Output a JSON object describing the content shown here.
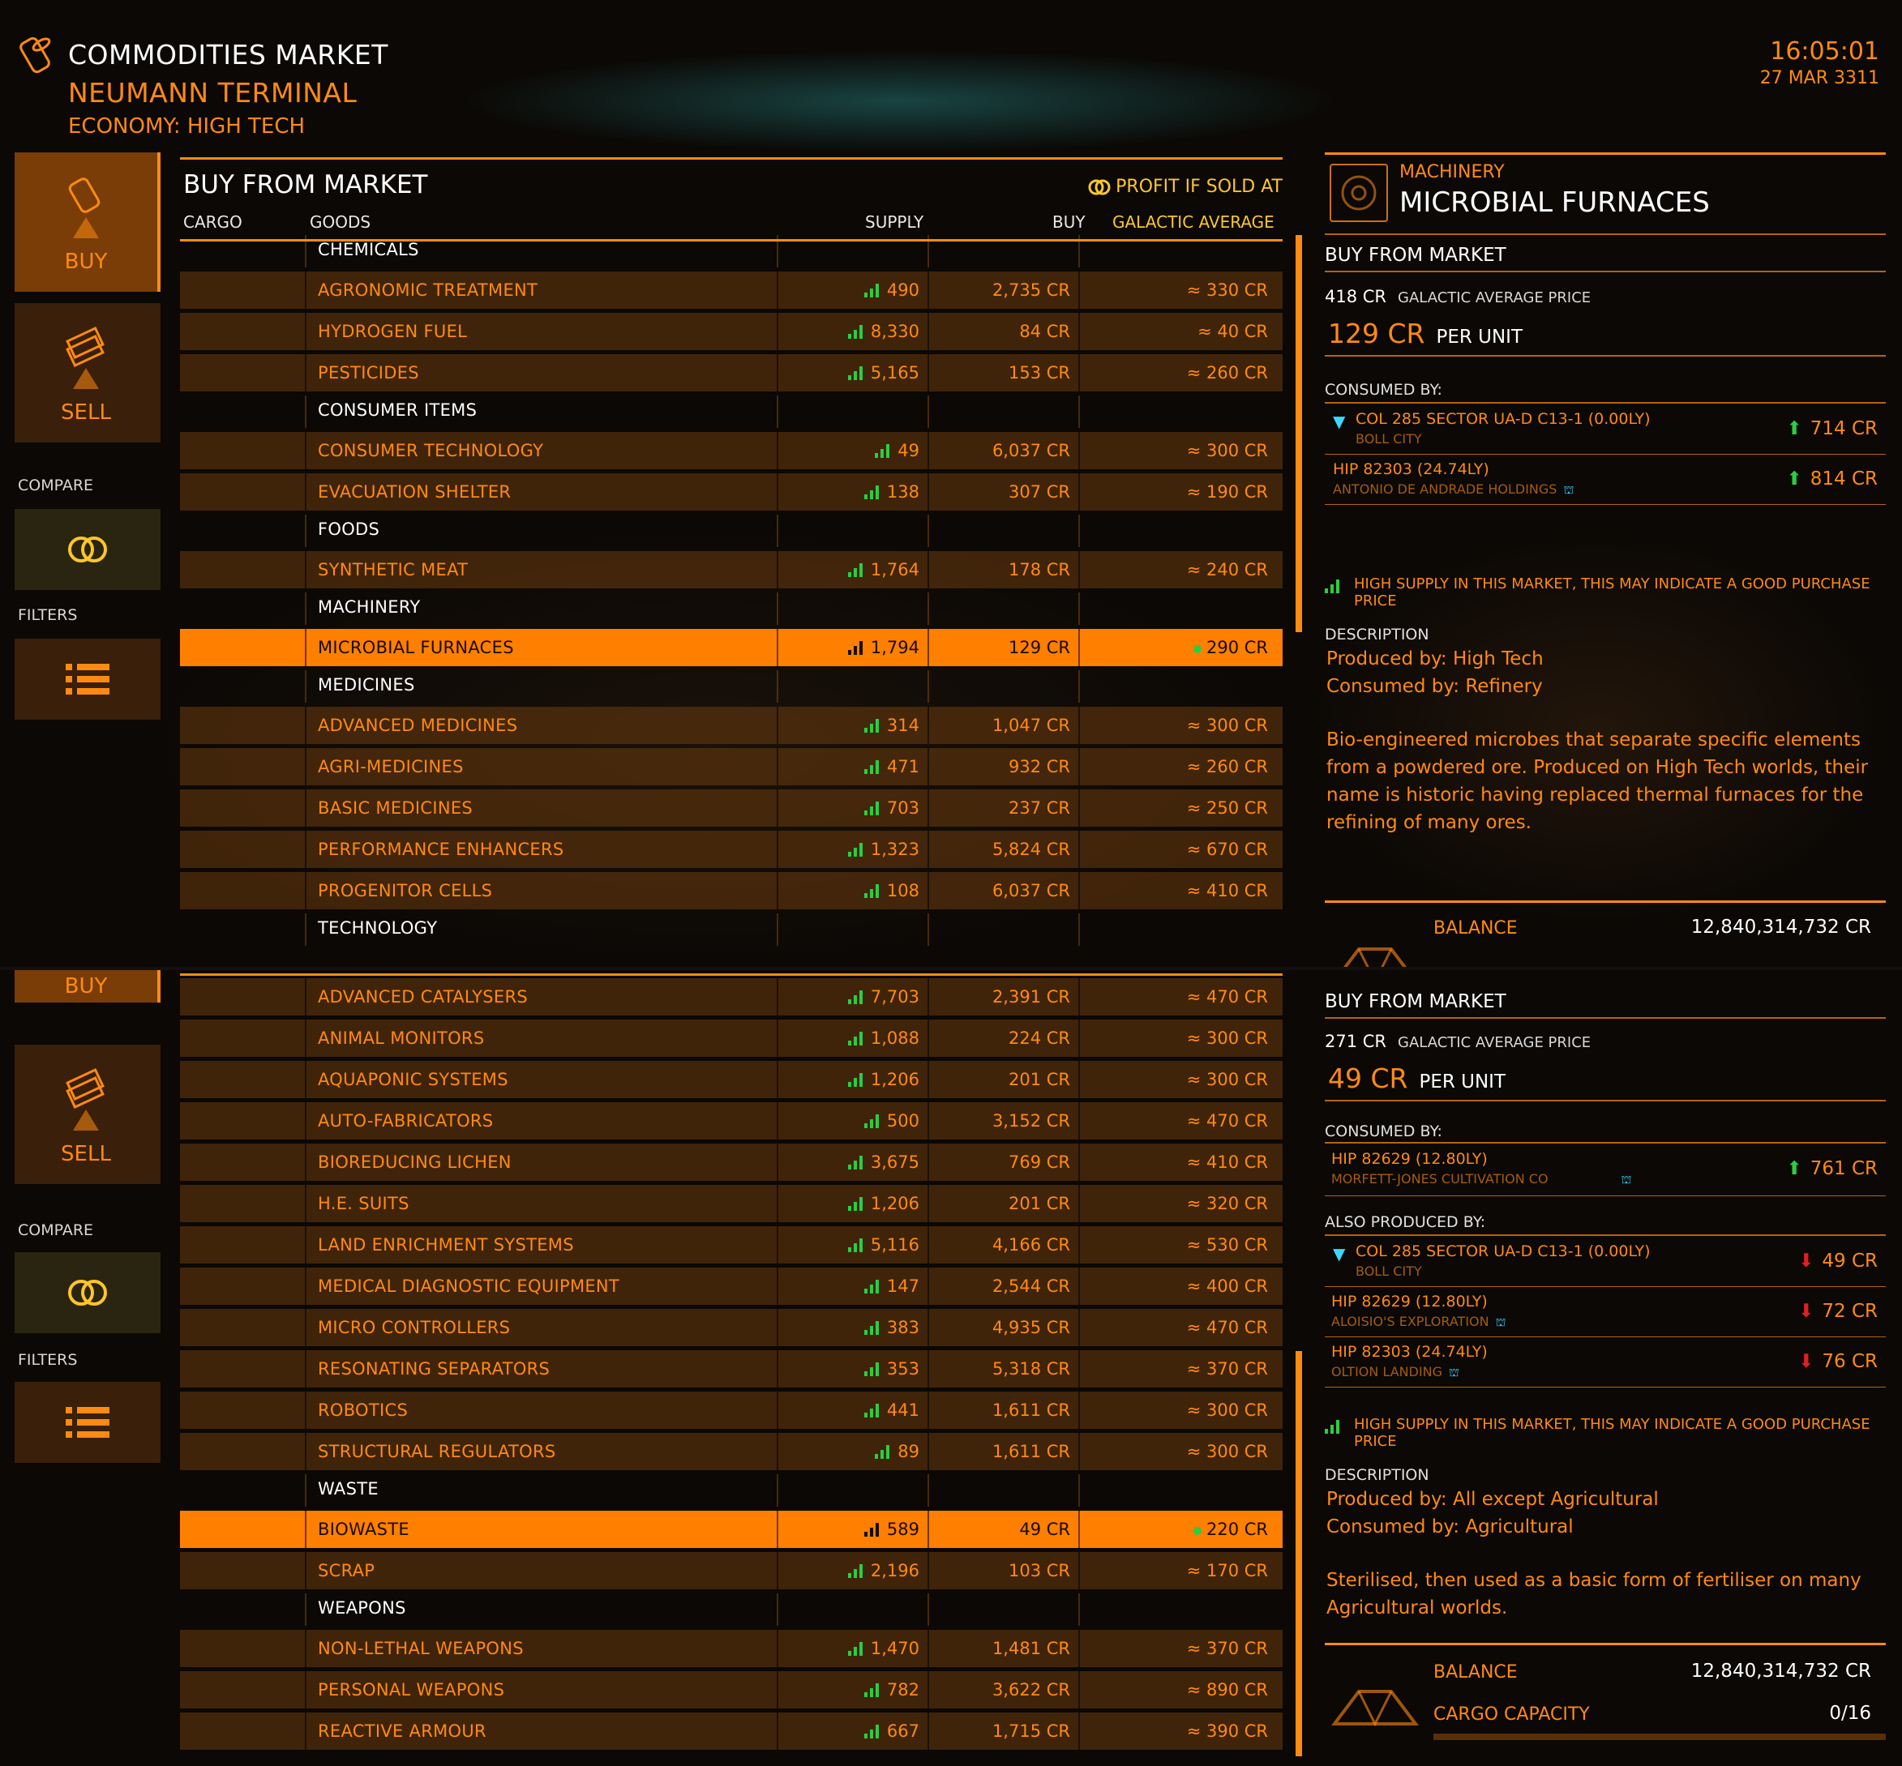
{
  "header": {
    "title": "COMMODITIES MARKET",
    "station": "NEUMANN TERMINAL",
    "economy": "ECONOMY: HIGH TECH",
    "time": "16:05:01",
    "date": "27 MAR 3311"
  },
  "sidebar": {
    "buy": "BUY",
    "sell": "SELL",
    "compare": "COMPARE",
    "filters": "FILTERS"
  },
  "market": {
    "title": "BUY FROM MARKET",
    "profit_label": "PROFIT IF SOLD AT",
    "columns": {
      "cargo": "CARGO",
      "goods": "GOODS",
      "supply": "SUPPLY",
      "buy": "BUY",
      "galactic": "GALACTIC AVERAGE"
    }
  },
  "top_rows": [
    {
      "type": "cat",
      "name": "CHEMICALS"
    },
    {
      "type": "item",
      "name": "AGRONOMIC TREATMENT",
      "supply": "490",
      "buy": "2,735 CR",
      "ga": "≈ 330 CR"
    },
    {
      "type": "item",
      "name": "HYDROGEN FUEL",
      "supply": "8,330",
      "buy": "84 CR",
      "ga": "≈ 40 CR"
    },
    {
      "type": "item",
      "name": "PESTICIDES",
      "supply": "5,165",
      "buy": "153 CR",
      "ga": "≈ 260 CR"
    },
    {
      "type": "cat",
      "name": "CONSUMER ITEMS"
    },
    {
      "type": "item",
      "name": "CONSUMER TECHNOLOGY",
      "supply": "49",
      "buy": "6,037 CR",
      "ga": "≈ 300 CR"
    },
    {
      "type": "item",
      "name": "EVACUATION SHELTER",
      "supply": "138",
      "buy": "307 CR",
      "ga": "≈ 190 CR"
    },
    {
      "type": "cat",
      "name": "FOODS"
    },
    {
      "type": "item",
      "name": "SYNTHETIC MEAT",
      "supply": "1,764",
      "buy": "178 CR",
      "ga": "≈ 240 CR"
    },
    {
      "type": "cat",
      "name": "MACHINERY"
    },
    {
      "type": "sel",
      "name": "MICROBIAL FURNACES",
      "supply": "1,794",
      "buy": "129 CR",
      "ga": "290 CR"
    },
    {
      "type": "cat",
      "name": "MEDICINES"
    },
    {
      "type": "item",
      "name": "ADVANCED MEDICINES",
      "supply": "314",
      "buy": "1,047 CR",
      "ga": "≈ 300 CR"
    },
    {
      "type": "item",
      "name": "AGRI-MEDICINES",
      "supply": "471",
      "buy": "932 CR",
      "ga": "≈ 260 CR"
    },
    {
      "type": "item",
      "name": "BASIC MEDICINES",
      "supply": "703",
      "buy": "237 CR",
      "ga": "≈ 250 CR"
    },
    {
      "type": "item",
      "name": "PERFORMANCE ENHANCERS",
      "supply": "1,323",
      "buy": "5,824 CR",
      "ga": "≈ 670 CR"
    },
    {
      "type": "item",
      "name": "PROGENITOR CELLS",
      "supply": "108",
      "buy": "6,037 CR",
      "ga": "≈ 410 CR"
    },
    {
      "type": "cat",
      "name": "TECHNOLOGY"
    }
  ],
  "bottom_rows": [
    {
      "type": "item",
      "name": "ADVANCED CATALYSERS",
      "supply": "7,703",
      "buy": "2,391 CR",
      "ga": "≈ 470 CR"
    },
    {
      "type": "item",
      "name": "ANIMAL MONITORS",
      "supply": "1,088",
      "buy": "224 CR",
      "ga": "≈ 300 CR"
    },
    {
      "type": "item",
      "name": "AQUAPONIC SYSTEMS",
      "supply": "1,206",
      "buy": "201 CR",
      "ga": "≈ 300 CR"
    },
    {
      "type": "item",
      "name": "AUTO-FABRICATORS",
      "supply": "500",
      "buy": "3,152 CR",
      "ga": "≈ 470 CR"
    },
    {
      "type": "item",
      "name": "BIOREDUCING LICHEN",
      "supply": "3,675",
      "buy": "769 CR",
      "ga": "≈ 410 CR"
    },
    {
      "type": "item",
      "name": "H.E. SUITS",
      "supply": "1,206",
      "buy": "201 CR",
      "ga": "≈ 320 CR"
    },
    {
      "type": "item",
      "name": "LAND ENRICHMENT SYSTEMS",
      "supply": "5,116",
      "buy": "4,166 CR",
      "ga": "≈ 530 CR"
    },
    {
      "type": "item",
      "name": "MEDICAL DIAGNOSTIC EQUIPMENT",
      "supply": "147",
      "buy": "2,544 CR",
      "ga": "≈ 400 CR"
    },
    {
      "type": "item",
      "name": "MICRO CONTROLLERS",
      "supply": "383",
      "buy": "4,935 CR",
      "ga": "≈ 470 CR"
    },
    {
      "type": "item",
      "name": "RESONATING SEPARATORS",
      "supply": "353",
      "buy": "5,318 CR",
      "ga": "≈ 370 CR"
    },
    {
      "type": "item",
      "name": "ROBOTICS",
      "supply": "441",
      "buy": "1,611 CR",
      "ga": "≈ 300 CR"
    },
    {
      "type": "item",
      "name": "STRUCTURAL REGULATORS",
      "supply": "89",
      "buy": "1,611 CR",
      "ga": "≈ 300 CR"
    },
    {
      "type": "cat",
      "name": "WASTE"
    },
    {
      "type": "sel",
      "name": "BIOWASTE",
      "supply": "589",
      "buy": "49 CR",
      "ga": "220 CR"
    },
    {
      "type": "item",
      "name": "SCRAP",
      "supply": "2,196",
      "buy": "103 CR",
      "ga": "≈ 170 CR"
    },
    {
      "type": "cat",
      "name": "WEAPONS"
    },
    {
      "type": "item",
      "name": "NON-LETHAL WEAPONS",
      "supply": "1,470",
      "buy": "1,481 CR",
      "ga": "≈ 370 CR"
    },
    {
      "type": "item",
      "name": "PERSONAL WEAPONS",
      "supply": "782",
      "buy": "3,622 CR",
      "ga": "≈ 890 CR"
    },
    {
      "type": "item",
      "name": "REACTIVE ARMOUR",
      "supply": "667",
      "buy": "1,715 CR",
      "ga": "≈ 390 CR"
    }
  ],
  "detail_top": {
    "category": "MACHINERY",
    "name": "MICROBIAL FURNACES",
    "section": "BUY FROM MARKET",
    "ga_price": "418 CR",
    "ga_label": "GALACTIC AVERAGE PRICE",
    "price": "129 CR",
    "per_unit": "PER UNIT",
    "consumed_by": "CONSUMED BY:",
    "consumers": [
      {
        "system": "COL 285 SECTOR UA-D C13-1 (0.00LY)",
        "station": "BOLL CITY",
        "price": "714 CR"
      },
      {
        "system": "HIP 82303 (24.74LY)",
        "station": "ANTONIO DE ANDRADE HOLDINGS",
        "price": "814 CR"
      }
    ],
    "supply_note": "HIGH SUPPLY IN THIS MARKET, THIS MAY INDICATE A GOOD PURCHASE PRICE",
    "description_label": "DESCRIPTION",
    "produced_by": "Produced by: High Tech",
    "consumed_by_text": "Consumed by: Refinery",
    "description": "Bio-engineered microbes that separate specific elements from a powdered ore. Produced on High Tech worlds, their name is historic having replaced thermal furnaces for the refining of many ores.",
    "balance_label": "BALANCE",
    "balance": "12,840,314,732 CR"
  },
  "detail_bottom": {
    "section": "BUY FROM MARKET",
    "ga_price": "271 CR",
    "ga_label": "GALACTIC AVERAGE PRICE",
    "price": "49 CR",
    "per_unit": "PER UNIT",
    "consumed_by": "CONSUMED BY:",
    "consumers": [
      {
        "system": "HIP 82629 (12.80LY)",
        "station": "MORFETT-JONES CULTIVATION CO",
        "price": "761 CR"
      }
    ],
    "also_produced": "ALSO PRODUCED BY:",
    "producers": [
      {
        "system": "COL 285 SECTOR UA-D C13-1 (0.00LY)",
        "station": "BOLL CITY",
        "price": "49 CR"
      },
      {
        "system": "HIP 82629 (12.80LY)",
        "station": "ALOISIO'S EXPLORATION",
        "price": "72 CR"
      },
      {
        "system": "HIP 82303 (24.74LY)",
        "station": "OLTION LANDING",
        "price": "76 CR"
      }
    ],
    "supply_note": "HIGH SUPPLY IN THIS MARKET, THIS MAY INDICATE A GOOD PURCHASE PRICE",
    "description_label": "DESCRIPTION",
    "produced_by": "Produced by: All except Agricultural",
    "consumed_by_text": "Consumed by: Agricultural",
    "description": "Sterilised, then used as a basic form of fertiliser on many Agricultural worlds.",
    "balance_label": "BALANCE",
    "balance": "12,840,314,732 CR",
    "cargo_label": "CARGO CAPACITY",
    "cargo": "0/16"
  },
  "colors": {
    "accent": "#ff8a12",
    "gold": "#ffc629",
    "green": "#2ecc40",
    "red": "#e02020",
    "cyan": "#3cd7ff"
  }
}
